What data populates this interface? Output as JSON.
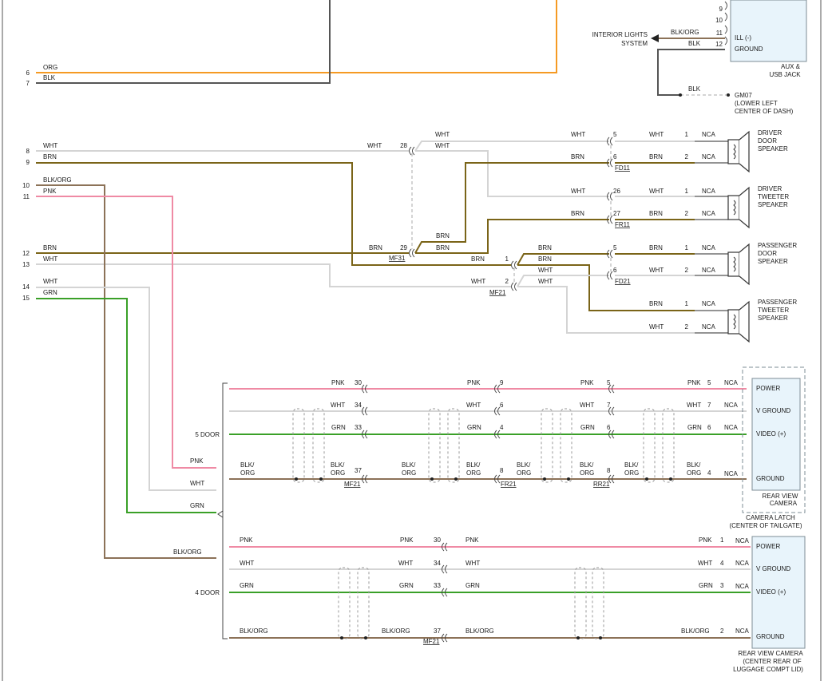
{
  "figure_id": "488485",
  "colors": {
    "ORG": "#f59a23",
    "BLK": "#555555",
    "WHT": "#d4d4d4",
    "BRN": "#7a6418",
    "PNK": "#ef8aa4",
    "GRN": "#3aa028",
    "BLKORG": "#8c7258",
    "box_fill": "#e8f4fb",
    "box_stroke": "#7e8d96"
  },
  "texts": {
    "c9": "9",
    "c10": "10",
    "c11": "11",
    "c12": "12",
    "ill": "ILL (-)",
    "ground": "GROUND",
    "aux1": "AUX &",
    "aux2": "USB JACK",
    "ils1": "INTERIOR LIGHTS",
    "ils2": "SYSTEM",
    "blkorg": "BLK/ORG",
    "blk": "BLK",
    "org": "ORG",
    "gm07": "GM07",
    "gm07a": "(LOWER LEFT",
    "gm07b": "CENTER OF DASH)",
    "p6": "6",
    "p7": "7",
    "p8": "8",
    "p9": "9",
    "p10": "10",
    "p11": "11",
    "p12": "12",
    "p13": "13",
    "p14": "14",
    "p15": "15",
    "wht": "WHT",
    "brn": "BRN",
    "pnk": "PNK",
    "grn": "GRN",
    "blk_sl": "BLK/",
    "org_2": "ORG",
    "n1": "1",
    "n2": "2",
    "n3": "3",
    "n4": "4",
    "n5": "5",
    "n6": "6",
    "n7": "7",
    "n8": "8",
    "n9": "9",
    "n26": "26",
    "n27": "27",
    "n28": "28",
    "n29": "29",
    "n30": "30",
    "n33": "33",
    "n34": "34",
    "n37": "37",
    "nca": "NCA",
    "fd11": "FD11",
    "fr11": "FR11",
    "mf31": "MF31",
    "mf21": "MF21",
    "fd21": "FD21",
    "fr21": "FR21",
    "rr21": "RR21",
    "dds1": "DRIVER",
    "dds2": "DOOR",
    "dds3": "SPEAKER",
    "dts1": "DRIVER",
    "dts2": "TWEETER",
    "dts3": "SPEAKER",
    "pds1": "PASSENGER",
    "pds2": "DOOR",
    "pds3": "SPEAKER",
    "pts1": "PASSENGER",
    "pts2": "TWEETER",
    "pts3": "SPEAKER",
    "door5": "5 DOOR",
    "door4": "4 DOOR",
    "power": "POWER",
    "vground": "V GROUND",
    "video": "VIDEO (+)",
    "rvc1": "REAR VIEW",
    "rvc2": "CAMERA",
    "cl1": "CAMERA LATCH",
    "cl2": "(CENTER OF TAILGATE)",
    "rvc4a": "REAR VIEW CAMERA",
    "rvc4b": "(CENTER REAR OF",
    "rvc4c": "LUGGAGE COMPT LID)"
  }
}
